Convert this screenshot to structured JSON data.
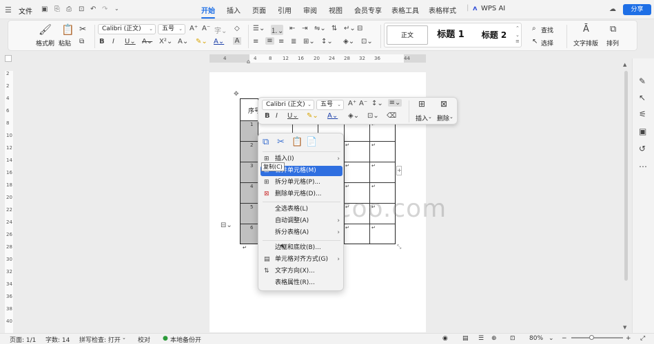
{
  "topbar": {
    "file_label": "文件",
    "tabs": [
      "开始",
      "插入",
      "页面",
      "引用",
      "审阅",
      "视图",
      "会员专享",
      "表格工具",
      "表格样式"
    ],
    "active_tab": "开始",
    "wps_ai": "WPS AI",
    "share": "分享"
  },
  "ribbon": {
    "format_painter": "格式刷",
    "paste": "粘贴",
    "font_name": "Calibri (正文)",
    "font_size": "五号",
    "styles": [
      "正文",
      "标题 1",
      "标题 2"
    ],
    "find": "查找",
    "select": "选择",
    "text_layout": "文字排版",
    "arrange": "排列"
  },
  "ruler": [
    "4",
    "4",
    "8",
    "12",
    "16",
    "20",
    "24",
    "28",
    "32",
    "36",
    "44"
  ],
  "vruler": [
    "2",
    "2",
    "4",
    "6",
    "8",
    "10",
    "12",
    "14",
    "16",
    "18",
    "20",
    "22",
    "24",
    "26",
    "28",
    "30",
    "32",
    "34",
    "36",
    "38",
    "40"
  ],
  "table": {
    "header": "序号",
    "rows": [
      "1",
      "2",
      "3",
      "4",
      "5",
      "6"
    ]
  },
  "mini_toolbar": {
    "font_name": "Calibri (正文)",
    "font_size": "五号",
    "insert": "插入",
    "delete": "删除"
  },
  "context_menu": {
    "items": [
      {
        "label": "插入(I)",
        "submenu": true
      },
      {
        "label": "合并单元格(M)",
        "highlighted": true
      },
      {
        "label": "拆分单元格(P)..."
      },
      {
        "label": "删除单元格(D)..."
      },
      {
        "label": "全选表格(L)"
      },
      {
        "label": "自动调整(A)",
        "submenu": true
      },
      {
        "label": "拆分表格(A)",
        "submenu": true
      },
      {
        "label": "边框和底纹(B)..."
      },
      {
        "label": "单元格对齐方式(G)",
        "submenu": true
      },
      {
        "label": "文字方向(X)..."
      },
      {
        "label": "表格属性(R)..."
      }
    ]
  },
  "tooltip": "复制(C)",
  "watermark": "khcoo.com",
  "status": {
    "page": "页面: 1/1",
    "words": "字数: 14",
    "spell": "拼写检查: 打开",
    "proof": "校对",
    "backup": "本地备份开",
    "zoom": "80%"
  },
  "colors": {
    "accent": "#1e6fe6",
    "highlight": "#2f6fe0"
  }
}
